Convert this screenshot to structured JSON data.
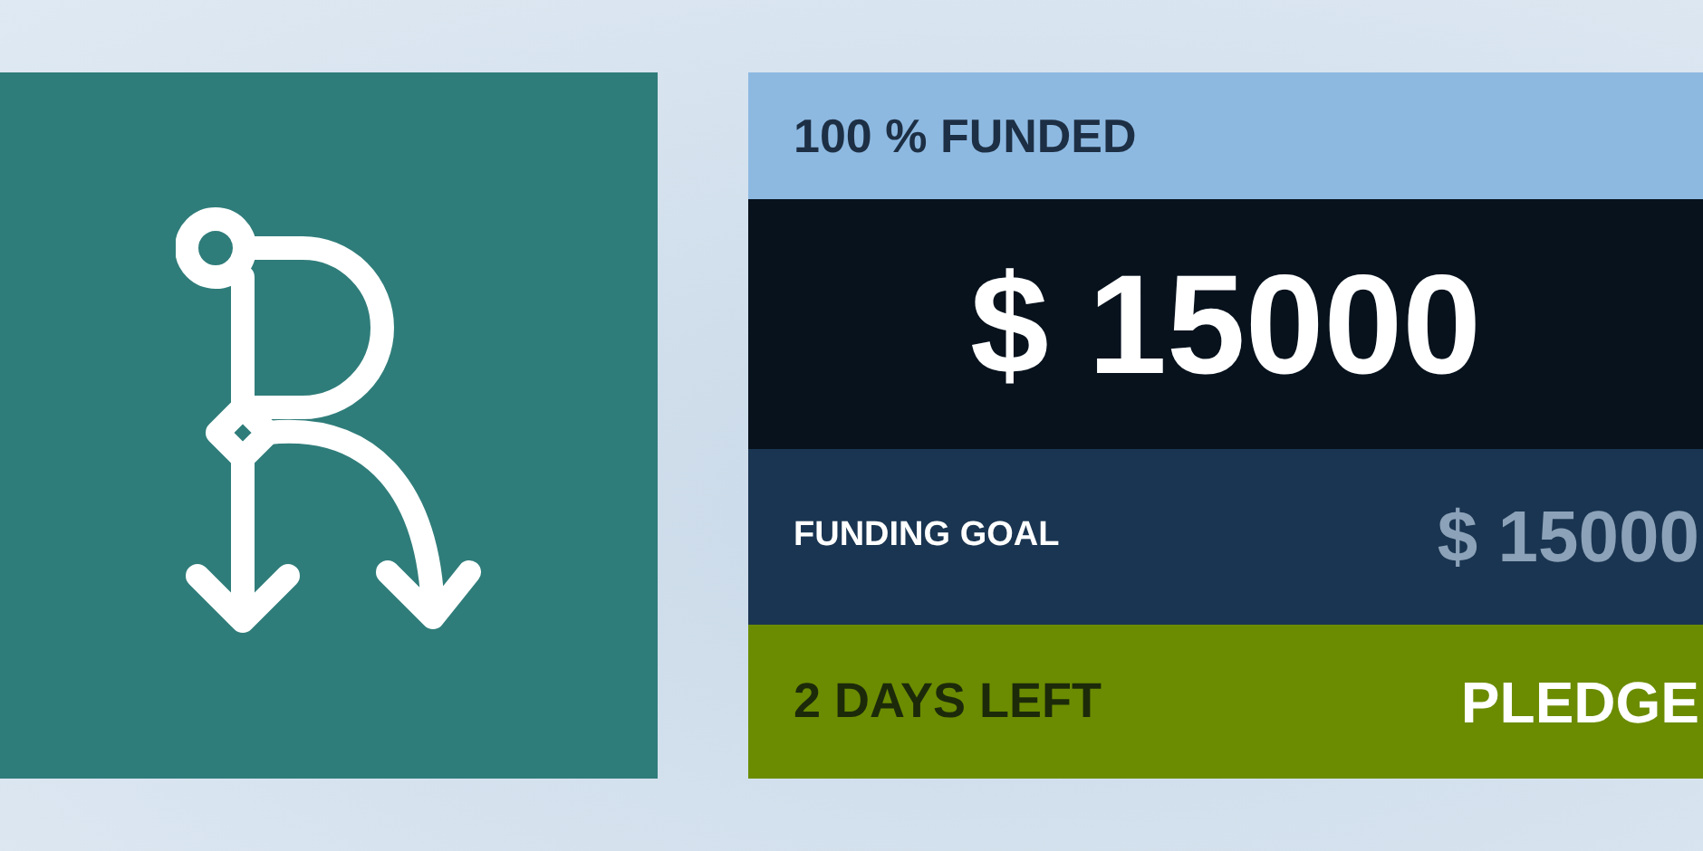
{
  "funded_label": "100 % FUNDED",
  "amount": "$ 15000",
  "goal": {
    "label": "FUNDING GOAL",
    "value": "$ 15000"
  },
  "footer": {
    "days_left": "2 DAYS LEFT",
    "action": "PLEDGE"
  }
}
